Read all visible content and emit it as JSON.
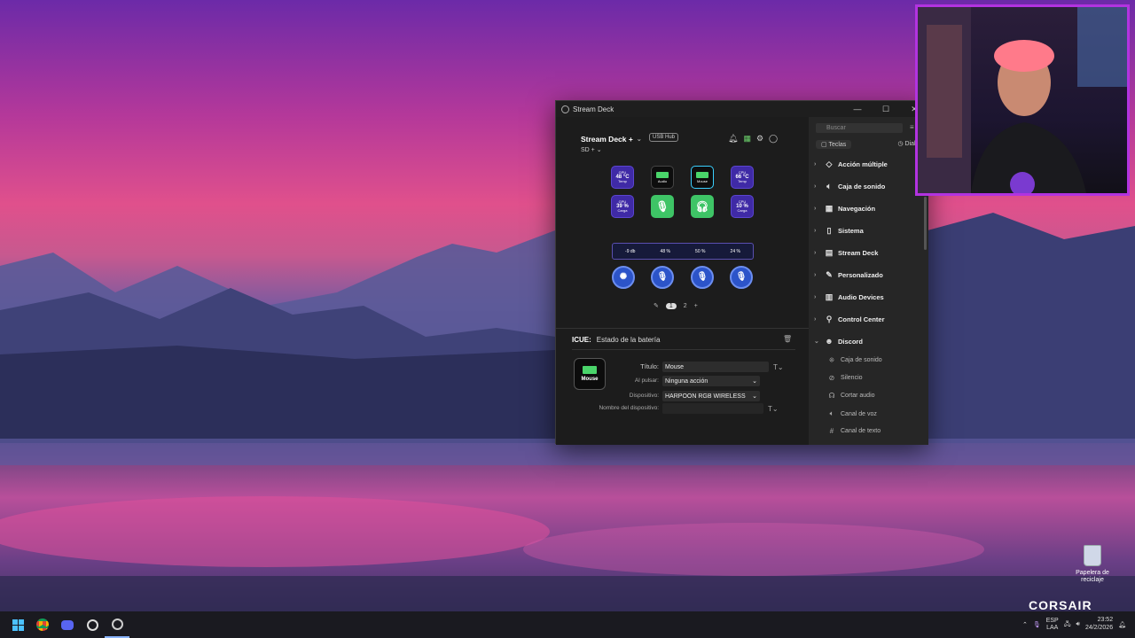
{
  "window": {
    "title": "Stream Deck",
    "minimize": "—",
    "maximize": "☐",
    "close": "✕"
  },
  "device": {
    "name": "Stream Deck +",
    "usb_hub": "USB Hub",
    "profile": "SD +"
  },
  "keys": [
    {
      "top": "GPU",
      "main": "48 °C",
      "bottom": "Temp"
    },
    {
      "bottom": "Audio"
    },
    {
      "bottom": "Mouse"
    },
    {
      "top": "CPU",
      "main": "66 °C",
      "bottom": "Temp"
    },
    {
      "top": "GPU",
      "main": "39 %",
      "bottom": "Carga"
    },
    {},
    {},
    {
      "top": "CPU",
      "main": "10 %",
      "bottom": "Carga"
    }
  ],
  "strip": [
    "-9 db",
    "48 %",
    "50 %",
    "24 %"
  ],
  "pager": {
    "page1": "1",
    "page2": "2",
    "add": "+"
  },
  "action": {
    "plugin": "ICUE:",
    "name": "Estado de la batería"
  },
  "preview_label": "Mouse",
  "form": {
    "title_label": "Título:",
    "title_value": "Mouse",
    "press_label": "Al pulsar:",
    "press_value": "Ninguna acción",
    "device_label": "Dispositivo:",
    "device_value": "HARPOON RGB WIRELESS",
    "devname_label": "Nombre del dispositivo:",
    "devname_value": ""
  },
  "sidebar": {
    "search_placeholder": "Buscar",
    "tab_keys": "Teclas",
    "tab_dials": "Diales",
    "categories": [
      {
        "label": "Acción múltiple",
        "icon": "multi-action-icon"
      },
      {
        "label": "Caja de sonido",
        "icon": "speaker-icon"
      },
      {
        "label": "Navegación",
        "icon": "navigation-icon"
      },
      {
        "label": "Sistema",
        "icon": "system-icon"
      },
      {
        "label": "Stream Deck",
        "icon": "stream-deck-icon"
      },
      {
        "label": "Personalizado",
        "icon": "custom-icon"
      },
      {
        "label": "Audio Devices",
        "icon": "audio-devices-icon"
      },
      {
        "label": "Control Center",
        "icon": "control-center-icon"
      },
      {
        "label": "Discord",
        "icon": "discord-icon"
      }
    ],
    "discord_items": [
      {
        "label": "Caja de sonido",
        "icon": "soundboard-icon"
      },
      {
        "label": "Silencio",
        "icon": "mute-icon"
      },
      {
        "label": "Cortar audio",
        "icon": "deafen-icon"
      },
      {
        "label": "Canal de voz",
        "icon": "voice-channel-icon"
      },
      {
        "label": "Canal de texto",
        "icon": "text-channel-icon"
      }
    ]
  },
  "desktop": {
    "recycle_bin": "Papelera de reciclaje",
    "watermark": "CORSAIR"
  },
  "taskbar": {
    "lang1": "ESP",
    "lang2": "LAA",
    "time": "23:52",
    "date": "24/2/2026"
  }
}
